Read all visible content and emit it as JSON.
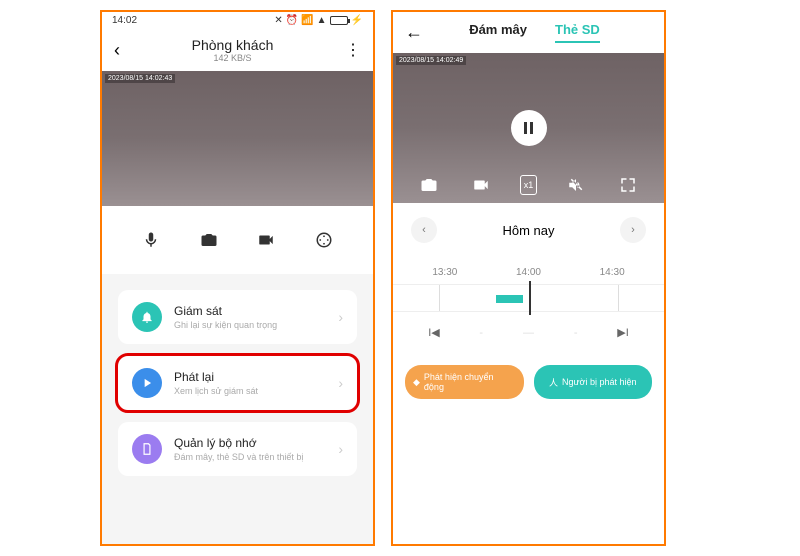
{
  "left": {
    "statusbar": {
      "time": "14:02",
      "batt_icon": "72"
    },
    "header": {
      "title": "Phòng khách",
      "subtitle": "142 KB/S"
    },
    "camera": {
      "timestamp": "2023/08/15 14:02:43"
    },
    "actions": {
      "mic": "mic",
      "photo": "camera",
      "video": "video",
      "ptz": "joystick"
    },
    "list": [
      {
        "icon": "bell",
        "title": "Giám sát",
        "sub": "Ghi lại sự kiện quan trọng"
      },
      {
        "icon": "play",
        "title": "Phát lại",
        "sub": "Xem lịch sử giám sát"
      },
      {
        "icon": "storage",
        "title": "Quản lý bộ nhớ",
        "sub": "Đám mây, thẻ SD và trên thiết bị"
      }
    ]
  },
  "right": {
    "tabs": {
      "cloud": "Đám mây",
      "sd": "Thẻ SD"
    },
    "camera": {
      "timestamp": "2023/08/15 14:02:49"
    },
    "camcontrols": {
      "photo": "camera",
      "record": "record",
      "speed": "x1",
      "mute": "mute",
      "fullscreen": "fullscreen"
    },
    "datenav": {
      "label": "Hôm nay"
    },
    "timeline": {
      "labels": [
        "13:30",
        "14:00",
        "14:30"
      ]
    },
    "pills": {
      "motion": "Phát hiện chuyển động",
      "person": "Người bị phát hiện"
    }
  }
}
